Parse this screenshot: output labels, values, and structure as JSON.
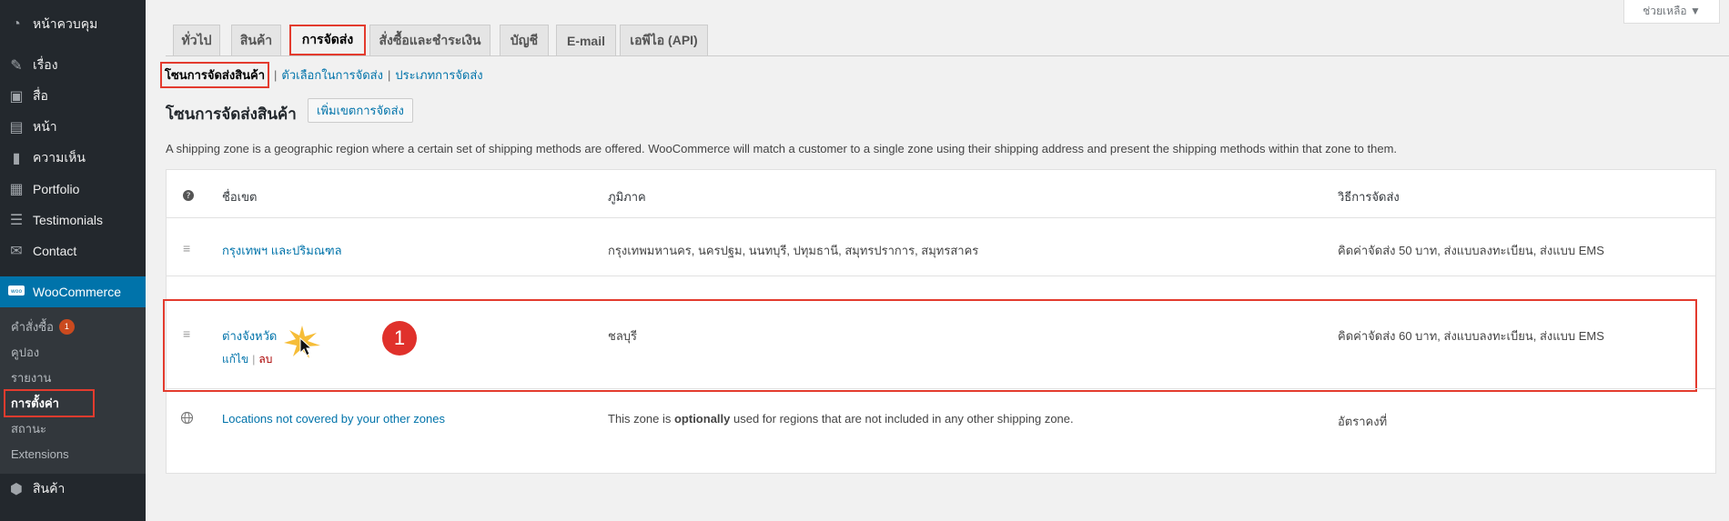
{
  "sidebar": {
    "items": [
      {
        "label": "หน้าควบคุม",
        "icon": "dashboard-icon"
      },
      {
        "label": "เรื่อง",
        "icon": "pin-icon"
      },
      {
        "label": "สื่อ",
        "icon": "media-icon"
      },
      {
        "label": "หน้า",
        "icon": "page-icon"
      },
      {
        "label": "ความเห็น",
        "icon": "comment-icon"
      },
      {
        "label": "Portfolio",
        "icon": "portfolio-icon"
      },
      {
        "label": "Testimonials",
        "icon": "testimonial-icon"
      },
      {
        "label": "Contact",
        "icon": "mail-icon"
      },
      {
        "label": "WooCommerce",
        "icon": "woo-icon"
      },
      {
        "label": "สินค้า",
        "icon": "box-icon"
      }
    ],
    "submenu": [
      {
        "label": "คำสั่งซื้อ",
        "badge": "1"
      },
      {
        "label": "คูปอง"
      },
      {
        "label": "รายงาน"
      },
      {
        "label": "การตั้งค่า"
      },
      {
        "label": "สถานะ"
      },
      {
        "label": "Extensions"
      }
    ]
  },
  "help": {
    "label": "ช่วยเหลือ ▼"
  },
  "tabs": [
    {
      "label": "ทั่วไป"
    },
    {
      "label": "สินค้า"
    },
    {
      "label": "การจัดส่ง"
    },
    {
      "label": "สั่งซื้อและชำระเงิน"
    },
    {
      "label": "บัญชี"
    },
    {
      "label": "E-mail"
    },
    {
      "label": "เอพีไอ (API)"
    }
  ],
  "subsub": {
    "current": "โซนการจัดส่งสินค้า",
    "options": "ตัวเลือกในการจัดส่ง",
    "classes": "ประเภทการจัดส่ง"
  },
  "page": {
    "title": "โซนการจัดส่งสินค้า",
    "add_zone": "เพิ่มเขตการจัดส่ง",
    "intro": "A shipping zone is a geographic region where a certain set of shipping methods are offered. WooCommerce will match a customer to a single zone using their shipping address and present the shipping methods within that zone to them."
  },
  "table": {
    "headers": {
      "name": "ชื่อเขต",
      "region": "ภูมิภาค",
      "methods": "วิธีการจัดส่ง"
    },
    "rows": [
      {
        "name": "กรุงเทพฯ และปริมณฑล",
        "region": "กรุงเทพมหานคร, นครปฐม, นนทบุรี, ปทุมธานี, สมุทรปราการ, สมุทรสาคร",
        "methods": "คิดค่าจัดส่ง 50 บาท, ส่งแบบลงทะเบียน, ส่งแบบ EMS"
      },
      {
        "name": "ต่างจังหวัด",
        "region": "ชลบุรี",
        "methods": "คิดค่าจัดส่ง 60 บาท, ส่งแบบลงทะเบียน, ส่งแบบ EMS",
        "edit": "แก้ไข",
        "delete": "ลบ"
      }
    ],
    "rest": {
      "name": "Locations not covered by your other zones",
      "region_prefix": "This zone is ",
      "region_bold": "optionally",
      "region_suffix": " used for regions that are not included in any other shipping zone.",
      "methods": "อัตราคงที่"
    }
  },
  "annotation": {
    "step": "1"
  }
}
